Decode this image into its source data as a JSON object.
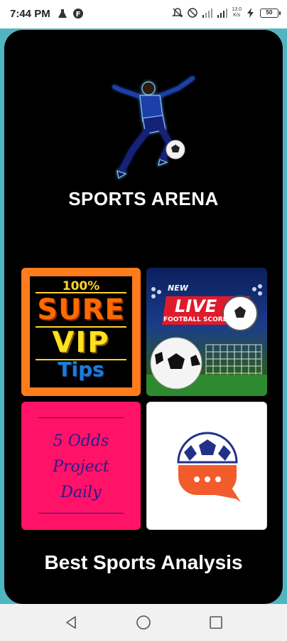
{
  "status_bar": {
    "time": "7:44 PM",
    "network_speed_top": "13.0",
    "network_speed_bottom": "K/s",
    "battery_level": "50"
  },
  "app": {
    "title": "SPORTS ARENA",
    "tagline": "Best Sports Analysis"
  },
  "tiles": {
    "vip": {
      "percent": "100%",
      "sure": "SURE",
      "vip": "VIP",
      "tips": "Tips"
    },
    "live": {
      "new": "NEW",
      "live": "LIVE",
      "score": "FOOTBALL SCORE"
    },
    "odds": {
      "line1": "5 Odds",
      "line2": "Project",
      "line3": "Daily"
    }
  },
  "nav": {
    "icons": [
      "back-icon",
      "home-icon",
      "recents-icon"
    ]
  },
  "colors": {
    "background": "#000000",
    "accent_teal": "#4fb5c2",
    "vip_orange": "#ff7b1c",
    "odds_pink": "#ff1267"
  }
}
